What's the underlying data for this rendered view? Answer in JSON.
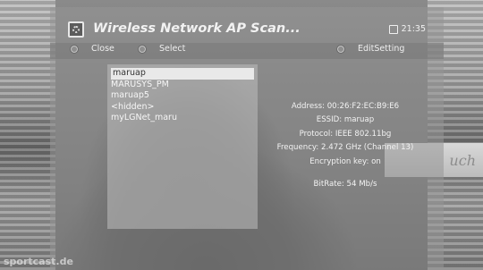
{
  "header": {
    "title": "Wireless Network AP Scan...",
    "time": "21:35",
    "app_icon": "settings-gear-icon",
    "clock_icon": "clock-icon"
  },
  "keys": {
    "close": "Close",
    "select": "Select",
    "edit_setting": "EditSetting"
  },
  "networks": [
    "maruap",
    "MARUSYS_PM",
    "maruap5",
    "<hidden>",
    "myLGNet_maru"
  ],
  "selected_index": 0,
  "details": {
    "address": "Address: 00:26:F2:EC:B9:E6",
    "essid": "ESSID: maruap",
    "protocol": "Protocol: IEEE 802.11bg",
    "frequency": "Frequency: 2.472 GHz (Channel 13)",
    "encryption": "Encryption key: on",
    "bitrate": "BitRate: 54 Mb/s"
  },
  "background": {
    "watermark": "sportcast.de",
    "board_text": "uch"
  },
  "colors": {
    "panel": "#969696",
    "selection": "#e9e9e9",
    "text": "#f2f2f2"
  }
}
